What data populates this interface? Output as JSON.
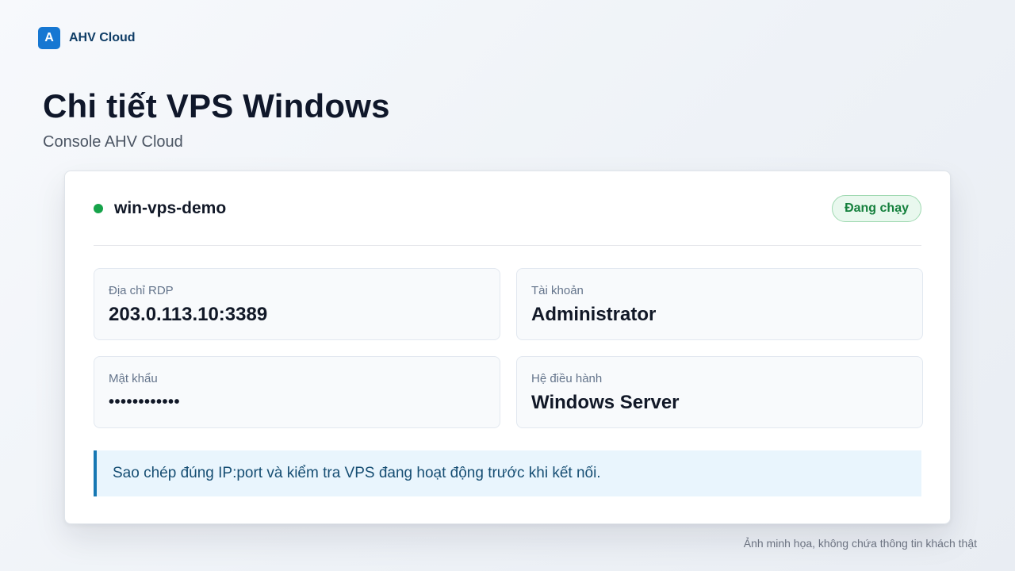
{
  "brand": {
    "logo_letter": "A",
    "name": "AHV Cloud"
  },
  "page": {
    "title": "Chi tiết VPS Windows",
    "subtitle": "Console AHV Cloud"
  },
  "vps": {
    "name": "win-vps-demo",
    "status": "Đang chạy",
    "status_color": "#16a34a",
    "fields": [
      {
        "label": "Địa chỉ RDP",
        "value": "203.0.113.10:3389"
      },
      {
        "label": "Tài khoản",
        "value": "Administrator"
      },
      {
        "label": "Mật khẩu",
        "value": "••••••••••••"
      },
      {
        "label": "Hệ điều hành",
        "value": "Windows Server"
      }
    ],
    "notice": "Sao chép đúng IP:port và kiểm tra VPS đang hoạt động trước khi kết nối."
  },
  "footnote": "Ảnh minh họa, không chứa thông tin khách thật",
  "colors": {
    "accent": "#1677d2",
    "status_green": "#15803d",
    "notice_bg": "#e9f5fd"
  }
}
